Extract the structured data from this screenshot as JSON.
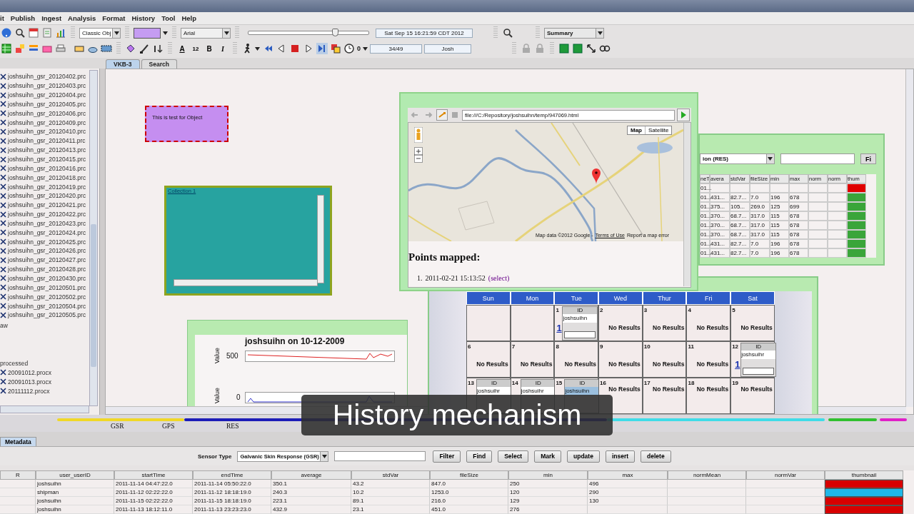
{
  "menu": [
    "it",
    "Publish",
    "Ingest",
    "Analysis",
    "Format",
    "History",
    "Tool",
    "Help"
  ],
  "toolbar": {
    "style_select": "Classic Obj",
    "font_select": "Arial",
    "format_buttons": [
      "A",
      "12",
      "B",
      "I"
    ],
    "time_slider": {
      "level": 0.72
    },
    "datetime": "Sat Sep 15 16:21:59 CDT 2012",
    "speed": "0",
    "counter": "34/49",
    "user": "Josh",
    "view_select": "Summary"
  },
  "tabs": [
    {
      "label": "VKB-3",
      "selected": true
    },
    {
      "label": "Search",
      "selected": false
    }
  ],
  "sidebar": {
    "items": [
      {
        "label": "joshsuihn_gsr_20120402.prc",
        "kind": "file"
      },
      {
        "label": "joshsuihn_gsr_20120403.prc",
        "kind": "file"
      },
      {
        "label": "joshsuihn_gsr_20120404.prc",
        "kind": "file"
      },
      {
        "label": "joshsuihn_gsr_20120405.prc",
        "kind": "file"
      },
      {
        "label": "joshsuihn_gsr_20120406.prc",
        "kind": "file"
      },
      {
        "label": "joshsuihn_gsr_20120409.prc",
        "kind": "file"
      },
      {
        "label": "joshsuihn_gsr_20120410.prc",
        "kind": "file"
      },
      {
        "label": "joshsuihn_gsr_20120411.prc",
        "kind": "file"
      },
      {
        "label": "joshsuihn_gsr_20120413.prc",
        "kind": "file"
      },
      {
        "label": "joshsuihn_gsr_20120415.prc",
        "kind": "file"
      },
      {
        "label": "joshsuihn_gsr_20120416.prc",
        "kind": "file"
      },
      {
        "label": "joshsuihn_gsr_20120418.prc",
        "kind": "file"
      },
      {
        "label": "joshsuihn_gsr_20120419.prc",
        "kind": "file"
      },
      {
        "label": "joshsuihn_gsr_20120420.prc",
        "kind": "file"
      },
      {
        "label": "joshsuihn_gsr_20120421.prc",
        "kind": "file"
      },
      {
        "label": "joshsuihn_gsr_20120422.prc",
        "kind": "file"
      },
      {
        "label": "joshsuihn_gsr_20120423.prc",
        "kind": "file"
      },
      {
        "label": "joshsuihn_gsr_20120424.prc",
        "kind": "file"
      },
      {
        "label": "joshsuihn_gsr_20120425.prc",
        "kind": "file"
      },
      {
        "label": "joshsuihn_gsr_20120426.prc",
        "kind": "file"
      },
      {
        "label": "joshsuihn_gsr_20120427.prc",
        "kind": "file"
      },
      {
        "label": "joshsuihn_gsr_20120428.prc",
        "kind": "file"
      },
      {
        "label": "joshsuihn_gsr_20120430.prc",
        "kind": "file"
      },
      {
        "label": "joshsuihn_gsr_20120501.prc",
        "kind": "file"
      },
      {
        "label": "joshsuihn_gsr_20120502.prc",
        "kind": "file"
      },
      {
        "label": "joshsuihn_gsr_20120504.prc",
        "kind": "file"
      },
      {
        "label": "joshsuihn_gsr_20120505.prc",
        "kind": "file"
      },
      {
        "label": "aw",
        "kind": "folder"
      },
      {
        "label": "processed",
        "kind": "folder",
        "children": [
          {
            "label": "20091012.procx",
            "kind": "file"
          },
          {
            "label": "20091013.procx",
            "kind": "file"
          },
          {
            "label": "20111112.procx",
            "kind": "file"
          }
        ]
      }
    ]
  },
  "canvas": {
    "note": {
      "text": "This is test for Object"
    },
    "collection": {
      "title": "Collection 1"
    },
    "chart_panel": {
      "title": "joshsuihn on 10-12-2009",
      "plots": [
        {
          "ylabel": "Value",
          "ytick": "500"
        },
        {
          "ylabel": "Value",
          "ytick": "0"
        }
      ]
    },
    "browser": {
      "url": "file:///C:/Repository/joshsuihn/temp/947069.html",
      "map_types": [
        {
          "label": "Map",
          "selected": true
        },
        {
          "label": "Satellite",
          "selected": false
        }
      ],
      "attribution": "Map data ©2012 Google -",
      "terms": "Terms of Use",
      "report": "Report a map error",
      "heading": "Points mapped:",
      "points": [
        {
          "number": "1.",
          "time": "2011-02-21 15:13:52",
          "link": "(select)"
        }
      ]
    },
    "table_window": {
      "select": "ion (RES)",
      "button": "Fi",
      "columns": [
        "neT",
        "avera",
        "stdVar",
        "fileSize",
        "min",
        "max",
        "norm",
        "norm",
        "thum"
      ],
      "rows": [
        {
          "c0": "01...",
          "color": "#e00000"
        },
        {
          "c0": "01...",
          "c1": "431...",
          "c2": "82.7...",
          "c3": "7.0",
          "c4": "196",
          "c5": "678",
          "color": "#3aa53a"
        },
        {
          "c0": "01...",
          "c1": "375...",
          "c2": "105...",
          "c3": "269.0",
          "c4": "125",
          "c5": "699",
          "color": "#3aa53a"
        },
        {
          "c0": "01...",
          "c1": "370...",
          "c2": "68.7...",
          "c3": "317.0",
          "c4": "115",
          "c5": "678",
          "color": "#3aa53a"
        },
        {
          "c0": "01...",
          "c1": "370...",
          "c2": "68.7...",
          "c3": "317.0",
          "c4": "115",
          "c5": "678",
          "color": "#3aa53a"
        },
        {
          "c0": "01...",
          "c1": "370...",
          "c2": "68.7...",
          "c3": "317.0",
          "c4": "115",
          "c5": "678",
          "color": "#3aa53a"
        },
        {
          "c0": "01...",
          "c1": "431...",
          "c2": "82.7...",
          "c3": "7.0",
          "c4": "196",
          "c5": "678",
          "color": "#3aa53a"
        },
        {
          "c0": "01...",
          "c1": "431...",
          "c2": "82.7...",
          "c3": "7.0",
          "c4": "196",
          "c5": "678",
          "color": "#3aa53a"
        }
      ]
    },
    "calendar": {
      "days": [
        "Sun",
        "Mon",
        "Tue",
        "Wed",
        "Thur",
        "Fri",
        "Sat"
      ],
      "weeks": [
        [
          {
            "kind": "empty"
          },
          {
            "kind": "empty"
          },
          {
            "kind": "result",
            "day": "1",
            "header": "ID",
            "name": "joshsuihn",
            "count": "1",
            "selected": false
          },
          {
            "kind": "none",
            "day": "2",
            "text": "No Results"
          },
          {
            "kind": "none",
            "day": "3",
            "text": "No Results"
          },
          {
            "kind": "none",
            "day": "4",
            "text": "No Results"
          },
          {
            "kind": "none",
            "day": "5",
            "text": "No Results"
          }
        ],
        [
          {
            "kind": "none",
            "day": "6",
            "text": "No Results"
          },
          {
            "kind": "none",
            "day": "7",
            "text": "No Results"
          },
          {
            "kind": "none",
            "day": "8",
            "text": "No Results"
          },
          {
            "kind": "none",
            "day": "9",
            "text": "No Results"
          },
          {
            "kind": "none",
            "day": "10",
            "text": "No Results"
          },
          {
            "kind": "none",
            "day": "11",
            "text": "No Results"
          },
          {
            "kind": "result",
            "day": "12",
            "header": "ID",
            "name": "joshsuihr",
            "count": "1",
            "selected": false
          }
        ],
        [
          {
            "kind": "result",
            "day": "13",
            "header": "ID",
            "name": "joshsuihr",
            "selected": false
          },
          {
            "kind": "result",
            "day": "14",
            "header": "ID",
            "name": "joshsuihr",
            "selected": false
          },
          {
            "kind": "result",
            "day": "15",
            "header": "ID",
            "name": "joshsuihn",
            "selected": true
          },
          {
            "kind": "none",
            "day": "16",
            "text": "No Results"
          },
          {
            "kind": "none",
            "day": "17",
            "text": "No Results"
          },
          {
            "kind": "none",
            "day": "18",
            "text": "No Results"
          },
          {
            "kind": "none",
            "day": "19",
            "text": "No Results"
          }
        ]
      ]
    }
  },
  "timeline": {
    "labels": [
      "GSR",
      "GPS",
      "RES"
    ],
    "segments": [
      {
        "color": "#f0d828"
      },
      {
        "color": "#1c1cb8"
      },
      {
        "color": "#40dce8"
      },
      {
        "color": "#30c030"
      },
      {
        "color": "#e020c8"
      }
    ]
  },
  "bottom": {
    "tabs": [
      {
        "label": "Metadata",
        "selected": true
      }
    ],
    "sensor_label": "Sensor Type",
    "sensor_select": "Galvanic Skin Response (GSR)",
    "buttons": [
      "Filter",
      "Find",
      "Select",
      "Mark",
      "update",
      "insert",
      "delete"
    ],
    "columns": [
      "R",
      "user_userID",
      "startTime",
      "endTime",
      "average",
      "stdVar",
      "fileSize",
      "min",
      "max",
      "normMean",
      "normVar",
      "thumbnail"
    ],
    "rows": [
      {
        "user": "joshsuihn",
        "start": "2011-11-14 04:47:22.0",
        "end": "2011-11-14 05:50:22.0",
        "average": "350.1",
        "stdVar": "43.2",
        "fileSize": "847.0",
        "min": "250",
        "max": "496",
        "color": "#d80000"
      },
      {
        "user": "shipman",
        "start": "2011-11-12 02:22:22.0",
        "end": "2011-11-12 18:18:19.0",
        "average": "240.3",
        "stdVar": "10.2",
        "fileSize": "1253.0",
        "min": "120",
        "max": "290",
        "color": "#20b8e8"
      },
      {
        "user": "joshsuihn",
        "start": "2011-11-15 02:22:22.0",
        "end": "2011-11-15 18:18:19.0",
        "average": "223.1",
        "stdVar": "89.1",
        "fileSize": "216.0",
        "min": "129",
        "max": "130",
        "color": "#d80000"
      },
      {
        "user": "joshsuihn",
        "start": "2011-11-13 18:12:11.0",
        "end": "2011-11-13 23:23:23.0",
        "average": "432.9",
        "stdVar": "23.1",
        "fileSize": "451.0",
        "min": "276",
        "color": "#d80000"
      }
    ]
  },
  "caption": "History mechanism"
}
